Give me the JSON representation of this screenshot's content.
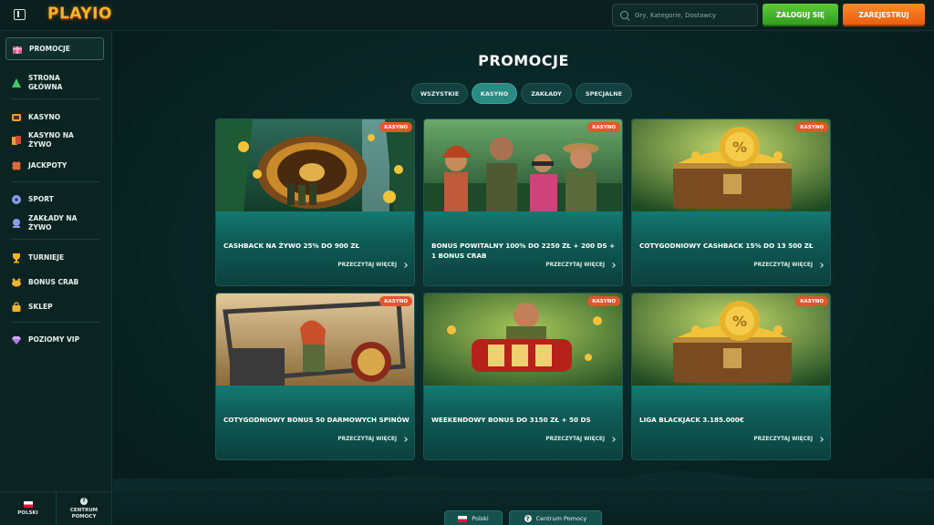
{
  "header": {
    "logo": "PLAYIO",
    "search_placeholder": "Gry, Kategorie, Dostawcy",
    "login_label": "ZALOGUJ SIĘ",
    "register_label": "ZAREJESTRUJ"
  },
  "sidebar": {
    "items": [
      {
        "label": "PROMOCJE",
        "icon": "gift-icon"
      },
      {
        "label": "STRONA GŁÓWNA",
        "icon": "home-triangle-icon"
      },
      {
        "label": "KASYNO",
        "icon": "slot-machine-icon"
      },
      {
        "label": "KASYNO NA ŻYWO",
        "icon": "live-cards-icon"
      },
      {
        "label": "JACKPOTY",
        "icon": "clover-icon"
      },
      {
        "label": "SPORT",
        "icon": "soccer-ball-icon"
      },
      {
        "label": "ZAKŁADY NA ŻYWO",
        "icon": "live-bet-icon"
      },
      {
        "label": "TURNIEJE",
        "icon": "trophy-icon"
      },
      {
        "label": "BONUS CRAB",
        "icon": "crab-icon"
      },
      {
        "label": "SKLEP",
        "icon": "shop-bag-icon"
      },
      {
        "label": "POZIOMY VIP",
        "icon": "diamond-icon"
      }
    ],
    "footer": {
      "language": "POLSKI",
      "help": "CENTRUM POMOCY",
      "help_glyph": "?"
    }
  },
  "main": {
    "title": "PROMOCJE",
    "tabs": [
      {
        "label": "WSZYSTKIE",
        "active": false
      },
      {
        "label": "KASYNO",
        "active": true
      },
      {
        "label": "ZAKŁADY",
        "active": false
      },
      {
        "label": "SPECJALNE",
        "active": false
      }
    ],
    "cards": [
      {
        "badge": "KASYNO",
        "title": "CASHBACK NA ŻYWO 25% DO 900 ZŁ",
        "link": "PRZECZYTAJ WIĘCEJ",
        "scene": "roulette"
      },
      {
        "badge": "KASYNO",
        "title": "BONUS POWITALNY 100% DO 2250 ZŁ + 200 DS + 1 BONUS CRAB",
        "link": "PRZECZYTAJ WIĘCEJ",
        "scene": "explorers"
      },
      {
        "badge": "KASYNO",
        "title": "COTYGODNIOWY CASHBACK 15% DO 13 500 ZŁ",
        "link": "PRZECZYTAJ WIĘCEJ",
        "scene": "chest"
      },
      {
        "badge": "KASYNO",
        "title": "COTYGODNIOWY BONUS 50 DARMOWYCH SPINÓW",
        "link": "PRZECZYTAJ WIĘCEJ",
        "scene": "buggy"
      },
      {
        "badge": "KASYNO",
        "title": "WEEKENDOWY BONUS DO 3150 ZŁ + 50 DS",
        "link": "PRZECZYTAJ WIĘCEJ",
        "scene": "slot"
      },
      {
        "badge": "KASYNO",
        "title": "LIGA BLACKJACK 3.185.000€",
        "link": "PRZECZYTAJ WIĘCEJ",
        "scene": "chest"
      }
    ],
    "footer_buttons": {
      "language": "Polski",
      "help": "Centrum Pomocy",
      "help_glyph": "?"
    }
  },
  "colors": {
    "accent_teal": "#2b8a82",
    "login_green": "#3aaa24",
    "register_orange": "#f07016",
    "badge_orange": "#e2562a",
    "logo_gold": "#f3b428"
  }
}
